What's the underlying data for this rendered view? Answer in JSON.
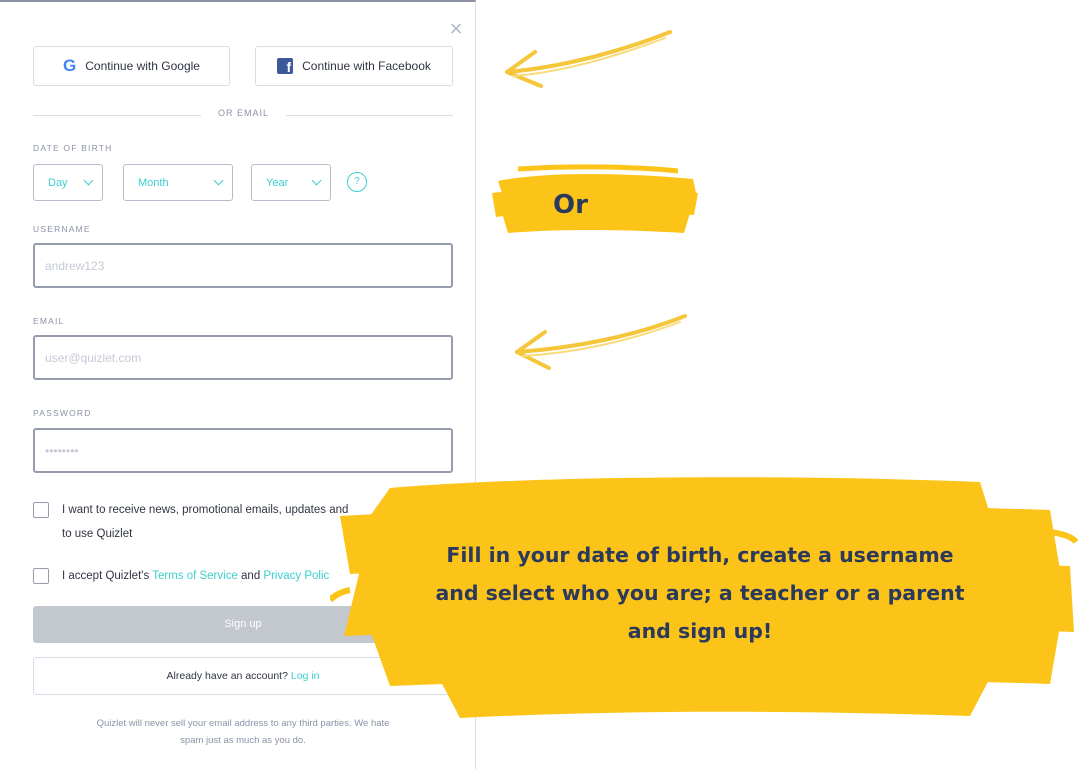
{
  "signup": {
    "close_icon": "×",
    "google_label": "Continue with Google",
    "facebook_label": "Continue with Facebook",
    "divider_text": "OR EMAIL",
    "dob_label": "DATE OF BIRTH",
    "dob_day": "Day",
    "dob_month": "Month",
    "dob_year": "Year",
    "help_icon": "?",
    "username_label": "USERNAME",
    "username_placeholder": "andrew123",
    "email_label": "EMAIL",
    "email_placeholder": "user@quizlet.com",
    "password_label": "PASSWORD",
    "password_placeholder": "••••••••",
    "news_line1": "I want to receive news, promotional emails, updates and",
    "news_line2": "to use Quizlet",
    "accept_prefix": "I accept Quizlet's ",
    "terms_link": "Terms of Service",
    "accept_and": " and ",
    "privacy_link": "Privacy Polic",
    "signup_button": "Sign up",
    "have_account": "Already have an account? ",
    "login_link": "Log in",
    "footer_note": "Quizlet will never sell your email address to any third parties. We hate spam just as much as you do.",
    "accent_color": "#3ccfcf",
    "facebook_color": "#3b5998"
  },
  "annotations": {
    "or_label": "Or",
    "callout_line1": "Fill in your date of birth, create a username",
    "callout_line2": "and select who you are; a teacher or a parent",
    "callout_line3": "and sign up!",
    "highlight_color": "#fcc419",
    "arrow_color": "#f5c53a"
  }
}
